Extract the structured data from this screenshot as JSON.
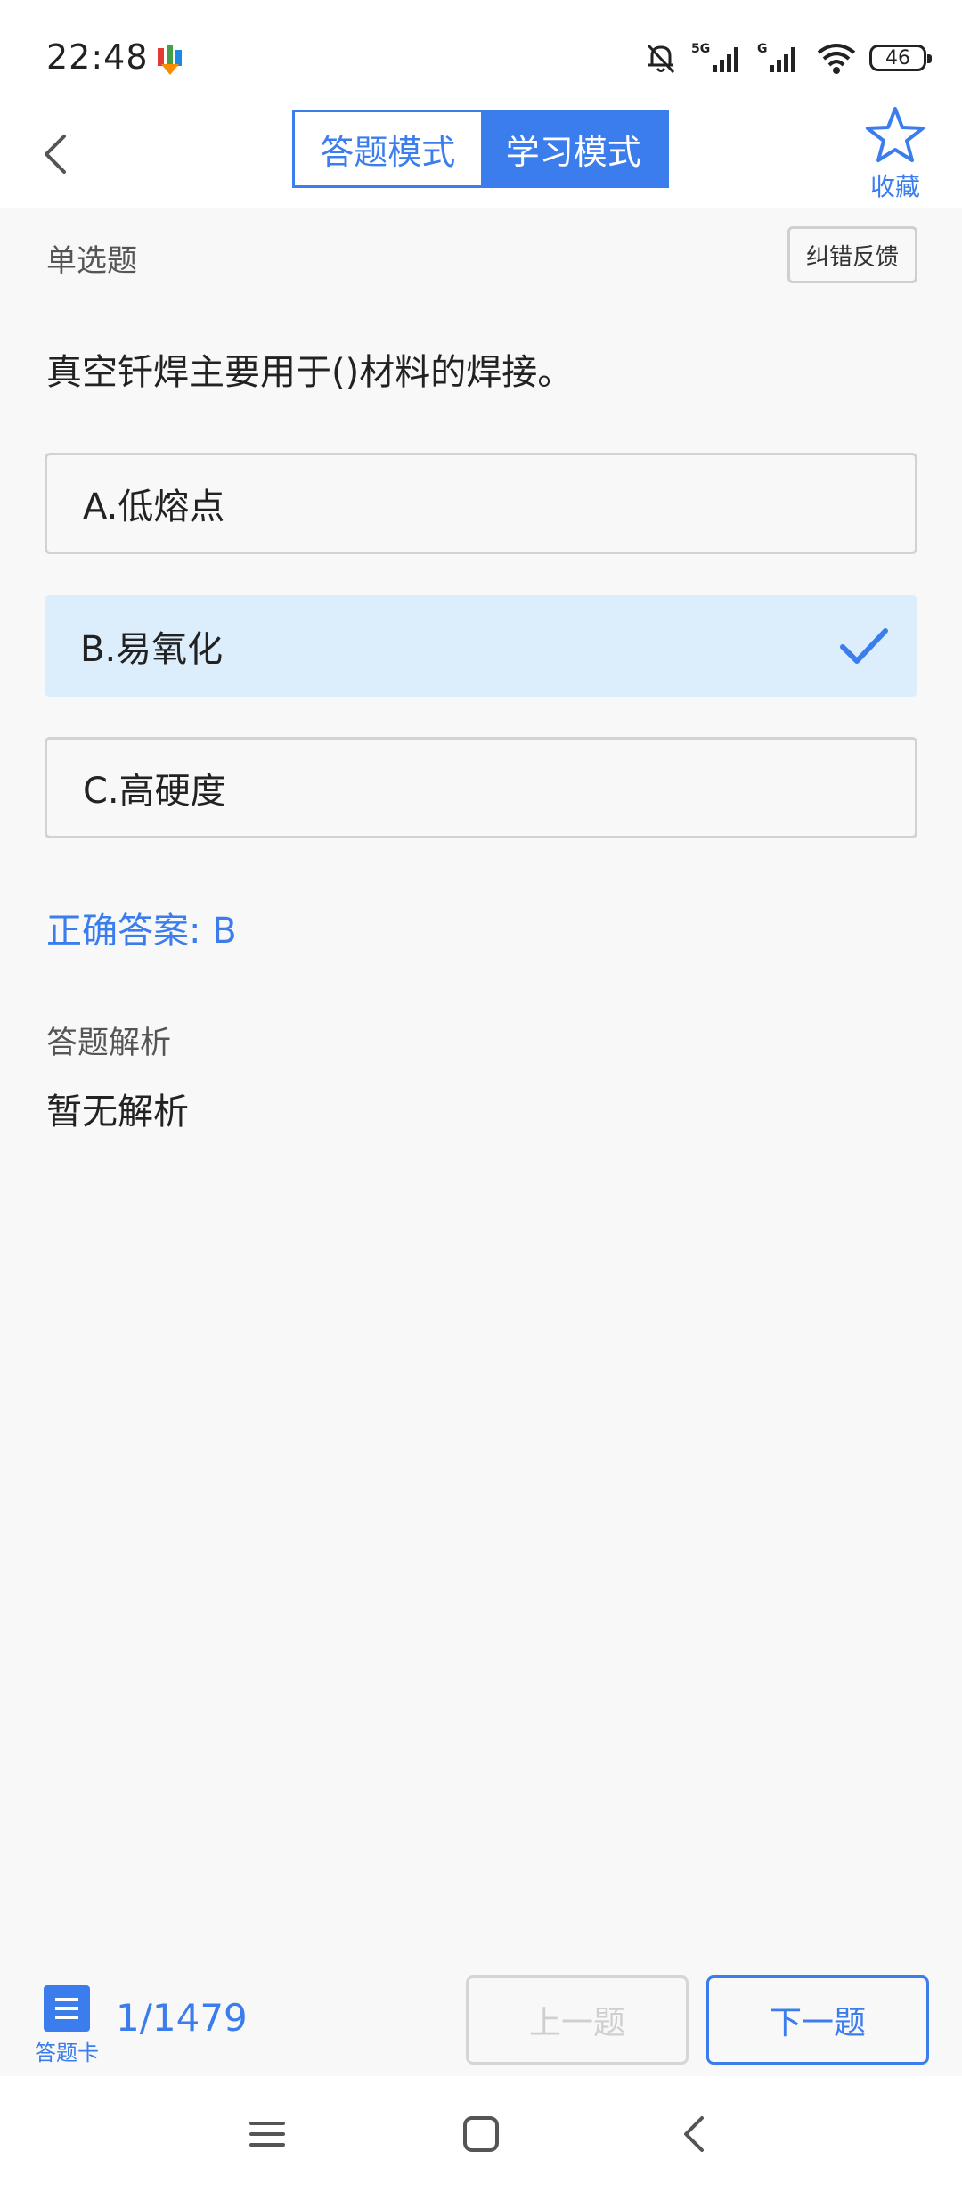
{
  "status_bar": {
    "time": "22:48",
    "battery": "46",
    "icons": [
      "app-notification-icon",
      "mute-bell-icon",
      "5g-signal-icon",
      "g-signal-icon",
      "wifi-icon",
      "battery-icon"
    ]
  },
  "header": {
    "tabs": [
      {
        "label": "答题模式",
        "active": false
      },
      {
        "label": "学习模式",
        "active": true
      }
    ],
    "favorite_label": "收藏"
  },
  "question": {
    "type": "单选题",
    "feedback_label": "纠错反馈",
    "text": "真空钎焊主要用于()材料的焊接。",
    "options": [
      {
        "label": "A.低熔点",
        "selected": false
      },
      {
        "label": "B.易氧化",
        "selected": true
      },
      {
        "label": "C.高硬度",
        "selected": false
      }
    ],
    "correct_answer": "正确答案: B",
    "analysis_title": "答题解析",
    "analysis_text": "暂无解析"
  },
  "footer": {
    "answer_card_label": "答题卡",
    "progress": "1/1479",
    "prev_label": "上一题",
    "next_label": "下一题"
  },
  "colors": {
    "accent": "#3b7ded",
    "selected_bg": "#dceefc",
    "background": "#f8f8f8"
  }
}
